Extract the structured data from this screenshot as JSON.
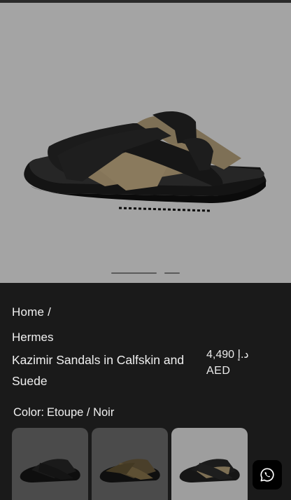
{
  "breadcrumb": {
    "home": "Home",
    "separator": "/"
  },
  "product": {
    "brand": "Hermes",
    "title": "Kazimir Sandals in Calfskin and Suede",
    "price_amount": "د.إ 4,490",
    "price_currency": "AED"
  },
  "color": {
    "label": "Color:",
    "value": "Etoupe / Noir"
  },
  "swatches": [
    {
      "name": "Noir"
    },
    {
      "name": "Etoupe"
    },
    {
      "name": "Etoupe / Noir"
    }
  ],
  "carousel": {
    "count": 2,
    "active": 1
  },
  "colors": {
    "background": "#1a1a1a",
    "hero_bg": "#a4a4a4",
    "suede": "#857559",
    "leather": "#1c1c1c"
  },
  "icons": {
    "chat": "whatsapp-icon"
  }
}
